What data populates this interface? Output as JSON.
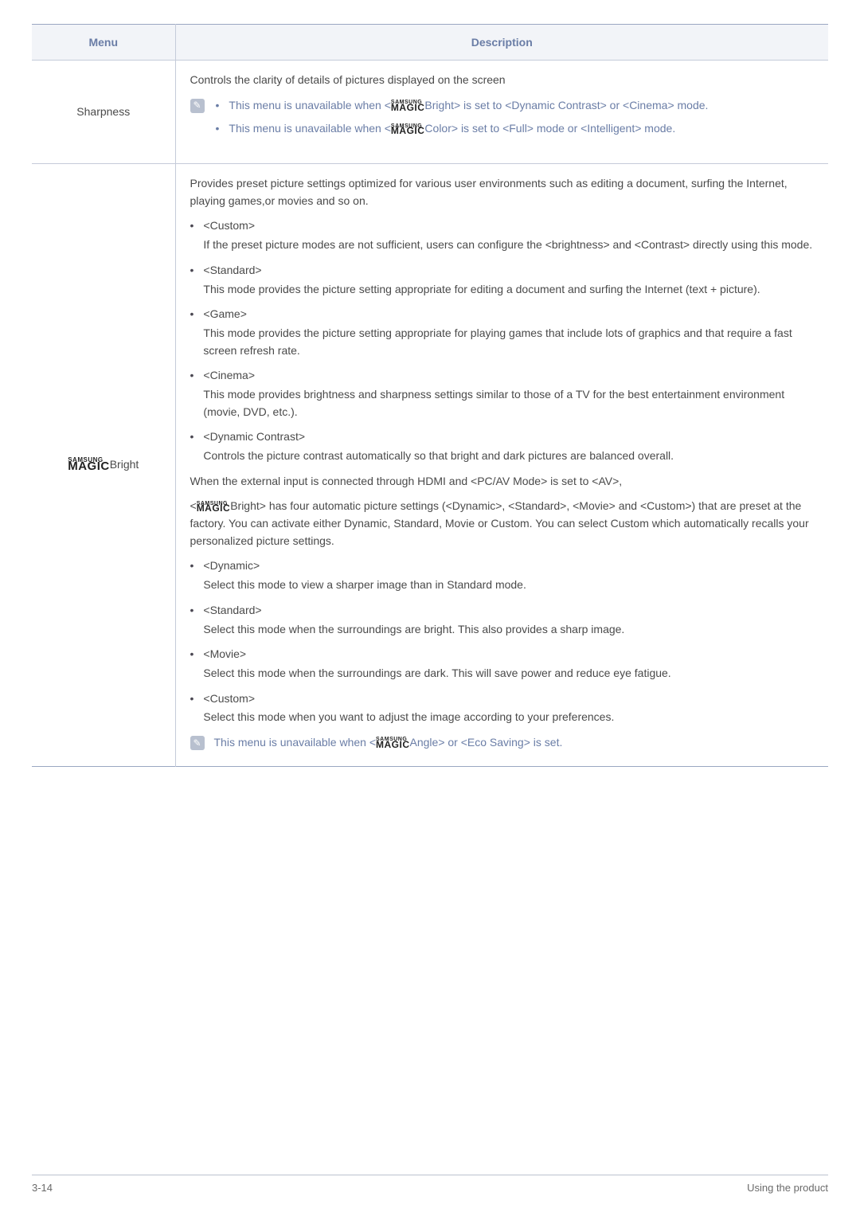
{
  "table": {
    "headers": {
      "menu": "Menu",
      "description": "Description"
    },
    "rows": [
      {
        "menu": "Sharpness",
        "desc": {
          "intro": "Controls the clarity of details of pictures displayed on the screen",
          "notes": [
            {
              "pre": "This menu is unavailable when <",
              "post": "Bright> is set to <Dynamic Contrast> or <Cinema> mode."
            },
            {
              "pre": "This menu is unavailable when <",
              "post": "Color> is set to <Full> mode or <Intelligent> mode."
            }
          ]
        }
      },
      {
        "menu_suffix": "Bright",
        "desc": {
          "intro": "Provides preset picture settings optimized for various user environments such as editing a document, surfing the Internet, playing games,or movies and so on.",
          "list1": [
            {
              "title": "<Custom>",
              "body": "If the preset picture modes are not sufficient, users can configure the <brightness> and <Contrast> directly using this mode."
            },
            {
              "title": "<Standard>",
              "body": " This mode provides the picture setting appropriate for editing a document and surfing the Internet (text + picture)."
            },
            {
              "title": "<Game>",
              "body": "This mode provides the picture setting appropriate for playing games that include lots of graphics and that require a fast screen refresh rate."
            },
            {
              "title": "<Cinema>",
              "body": "This mode provides brightness and sharpness settings similar to those of a TV for the best entertainment environment (movie, DVD, etc.)."
            },
            {
              "title": "<Dynamic Contrast>",
              "body": "Controls the picture contrast automatically so that bright and dark pictures are balanced overall."
            }
          ],
          "mid1": "When the external input is connected through HDMI and <PC/AV Mode> is set to <AV>,",
          "mid2_pre": "<",
          "mid2_post": "Bright> has four automatic picture settings (<Dynamic>, <Standard>, <Movie> and <Custom>) that are preset at the factory. You can activate either Dynamic, Standard, Movie or Custom. You can select Custom which automatically recalls your personalized picture settings.",
          "list2": [
            {
              "title": "<Dynamic>",
              "body": "Select this mode to view a sharper image than in Standard mode."
            },
            {
              "title": "<Standard>",
              "body": "Select this mode when the surroundings are bright. This also provides a sharp image."
            },
            {
              "title": "<Movie>",
              "body": "Select this mode when the surroundings are dark. This will save power and reduce eye fatigue."
            },
            {
              "title": "<Custom>",
              "body": "Select this mode when you want to adjust the image according to your preferences."
            }
          ],
          "note_tail": {
            "pre": "This menu is unavailable when <",
            "post": "Angle> or <Eco Saving> is set."
          }
        }
      }
    ]
  },
  "logo": {
    "top": "SAMSUNG",
    "bot": "MAGIC"
  },
  "footer": {
    "left": "3-14",
    "right": "Using the product"
  }
}
